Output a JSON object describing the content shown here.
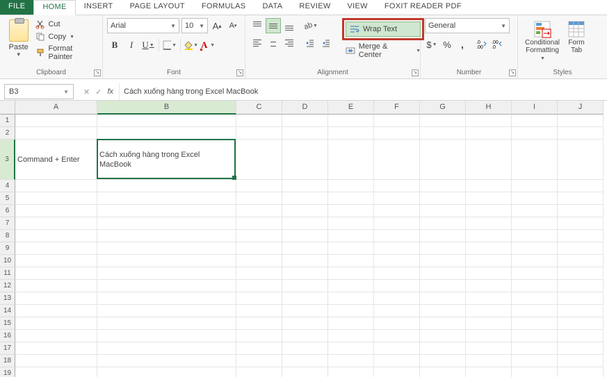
{
  "tabs": {
    "file": "FILE",
    "home": "HOME",
    "insert": "INSERT",
    "pagelayout": "PAGE LAYOUT",
    "formulas": "FORMULAS",
    "data": "DATA",
    "review": "REVIEW",
    "view": "VIEW",
    "foxit": "FOXIT READER PDF"
  },
  "clipboard": {
    "paste": "Paste",
    "cut": "Cut",
    "copy": "Copy",
    "fmtpainter": "Format Painter",
    "label": "Clipboard"
  },
  "font": {
    "name": "Arial",
    "size": "10",
    "label": "Font"
  },
  "alignment": {
    "wrap": "Wrap Text",
    "merge": "Merge & Center",
    "label": "Alignment"
  },
  "number": {
    "format": "General",
    "label": "Number"
  },
  "styles": {
    "cond": "Conditional Formatting",
    "cond1": "Conditional",
    "cond2": "Formatting",
    "fmt": "Form",
    "tab": "Tab",
    "label": "Styles"
  },
  "namebox": "B3",
  "formula": "Cách xuống hàng trong Excel MacBook",
  "cols": {
    "widths": [
      118,
      200,
      66,
      66,
      66,
      66,
      66,
      66,
      66,
      66
    ],
    "labels": [
      "A",
      "B",
      "C",
      "D",
      "E",
      "F",
      "G",
      "H",
      "I",
      "J"
    ]
  },
  "cells": {
    "a3": "Command + Enter",
    "b3": "Cách xuống hàng trong Excel MacBook"
  },
  "rowcount": 19,
  "selected": {
    "row": 3,
    "col": 1
  }
}
